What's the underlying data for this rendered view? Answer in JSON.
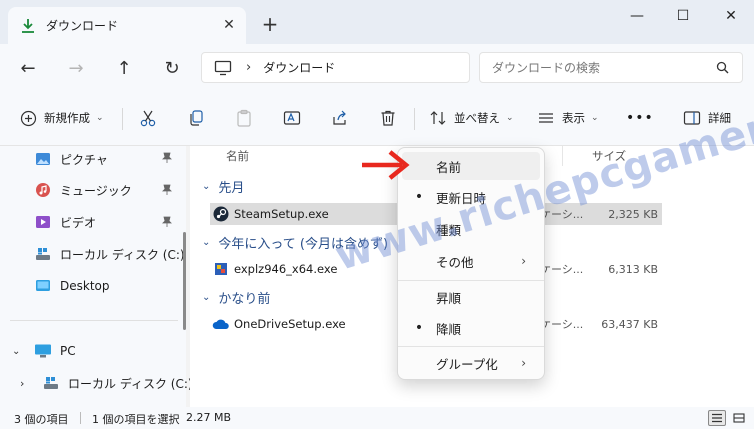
{
  "window": {
    "tab_title": "ダウンロード",
    "tab_close": "✕",
    "new_tab": "+",
    "minimize": "—",
    "maximize": "☐",
    "close": "✕"
  },
  "nav": {
    "back": "←",
    "forward": "→",
    "up": "↑",
    "refresh": "↻",
    "breadcrumb_sep": "›",
    "breadcrumb": "ダウンロード",
    "search_placeholder": "ダウンロードの検索"
  },
  "toolbar": {
    "new_label": "新規作成",
    "sort_label": "並べ替え",
    "view_label": "表示",
    "more_label": "•••",
    "details_label": "詳細"
  },
  "sidebar": {
    "items": [
      {
        "label": "ピクチャ",
        "icon": "pictures-icon",
        "pinned": true
      },
      {
        "label": "ミュージック",
        "icon": "music-icon",
        "pinned": true
      },
      {
        "label": "ビデオ",
        "icon": "videos-icon",
        "pinned": true
      },
      {
        "label": "ローカル ディスク (C:)",
        "icon": "drive-icon",
        "pinned": false
      },
      {
        "label": "Desktop",
        "icon": "desktop-folder-icon",
        "pinned": false
      }
    ],
    "pc_label": "PC",
    "pc_child": "ローカル ディスク (C:)",
    "pin_glyph": "📌"
  },
  "main": {
    "col_name": "名前",
    "col_size": "サイズ",
    "groups": [
      {
        "label": "先月",
        "files": [
          {
            "name": "SteamSetup.exe",
            "type": "ケーシ...",
            "size": "2,325 KB",
            "icon": "steam-icon",
            "selected": true
          }
        ]
      },
      {
        "label": "今年に入って (今月は含めず)",
        "files": [
          {
            "name": "explz946_x64.exe",
            "type": "ケーシ...",
            "size": "6,313 KB",
            "icon": "installer-icon",
            "selected": false
          }
        ]
      },
      {
        "label": "かなり前",
        "files": [
          {
            "name": "OneDriveSetup.exe",
            "type": "ケーシ...",
            "size": "63,437 KB",
            "icon": "onedrive-icon",
            "selected": false
          }
        ]
      }
    ]
  },
  "sort_menu": {
    "items": [
      {
        "label": "名前",
        "checked": false,
        "submenu": false
      },
      {
        "label": "更新日時",
        "checked": true,
        "submenu": false
      },
      {
        "label": "種類",
        "checked": false,
        "submenu": false
      },
      {
        "label": "その他",
        "checked": false,
        "submenu": true
      },
      {
        "label": "昇順",
        "checked": false,
        "submenu": false
      },
      {
        "label": "降順",
        "checked": true,
        "submenu": false
      },
      {
        "label": "グループ化",
        "checked": false,
        "submenu": true
      }
    ],
    "bullet": "•",
    "submenu_glyph": "›"
  },
  "status": {
    "item_count": "3 個の項目",
    "selection": "1 個の項目を選択",
    "selection_size": "2.27 MB"
  },
  "watermark": "www.richepcgamer.com",
  "colors": {
    "accent": "#0067c0",
    "group_header": "#2a4f8a",
    "arrow": "#e8281e",
    "watermark": "#6e8cd2"
  }
}
